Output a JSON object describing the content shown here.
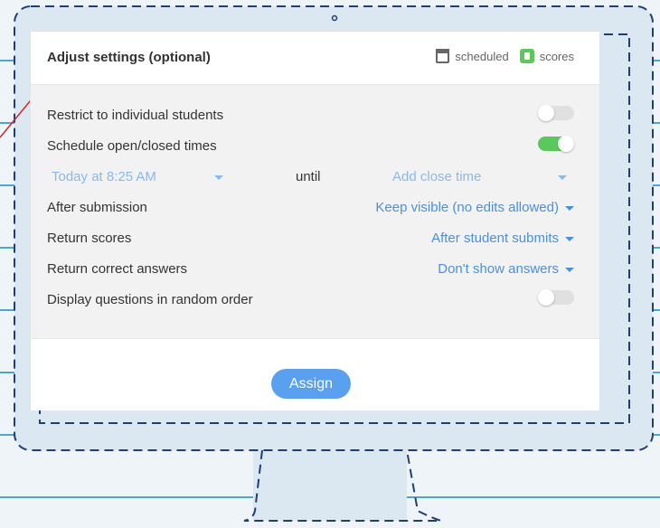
{
  "header": {
    "title": "Adjust settings (optional)",
    "legend": [
      {
        "label": "scheduled",
        "icon": "calendar-icon"
      },
      {
        "label": "scores",
        "icon": "scores-icon"
      }
    ]
  },
  "settings": {
    "restrict": {
      "label": "Restrict to individual students",
      "enabled": false
    },
    "schedule": {
      "label": "Schedule open/closed times",
      "enabled": true
    },
    "time": {
      "open": "Today at 8:25 AM",
      "until": "until",
      "close": "Add close time"
    },
    "after_submission": {
      "label": "After submission",
      "value": "Keep visible (no edits allowed)"
    },
    "return_scores": {
      "label": "Return scores",
      "value": "After student submits"
    },
    "return_answers": {
      "label": "Return correct answers",
      "value": "Don't show answers"
    },
    "random_order": {
      "label": "Display questions in random order",
      "enabled": false
    }
  },
  "footer": {
    "assign_label": "Assign"
  },
  "colors": {
    "accent": "#4a90e2",
    "toggle_on": "#58c95a",
    "button": "#5aa0f0"
  }
}
